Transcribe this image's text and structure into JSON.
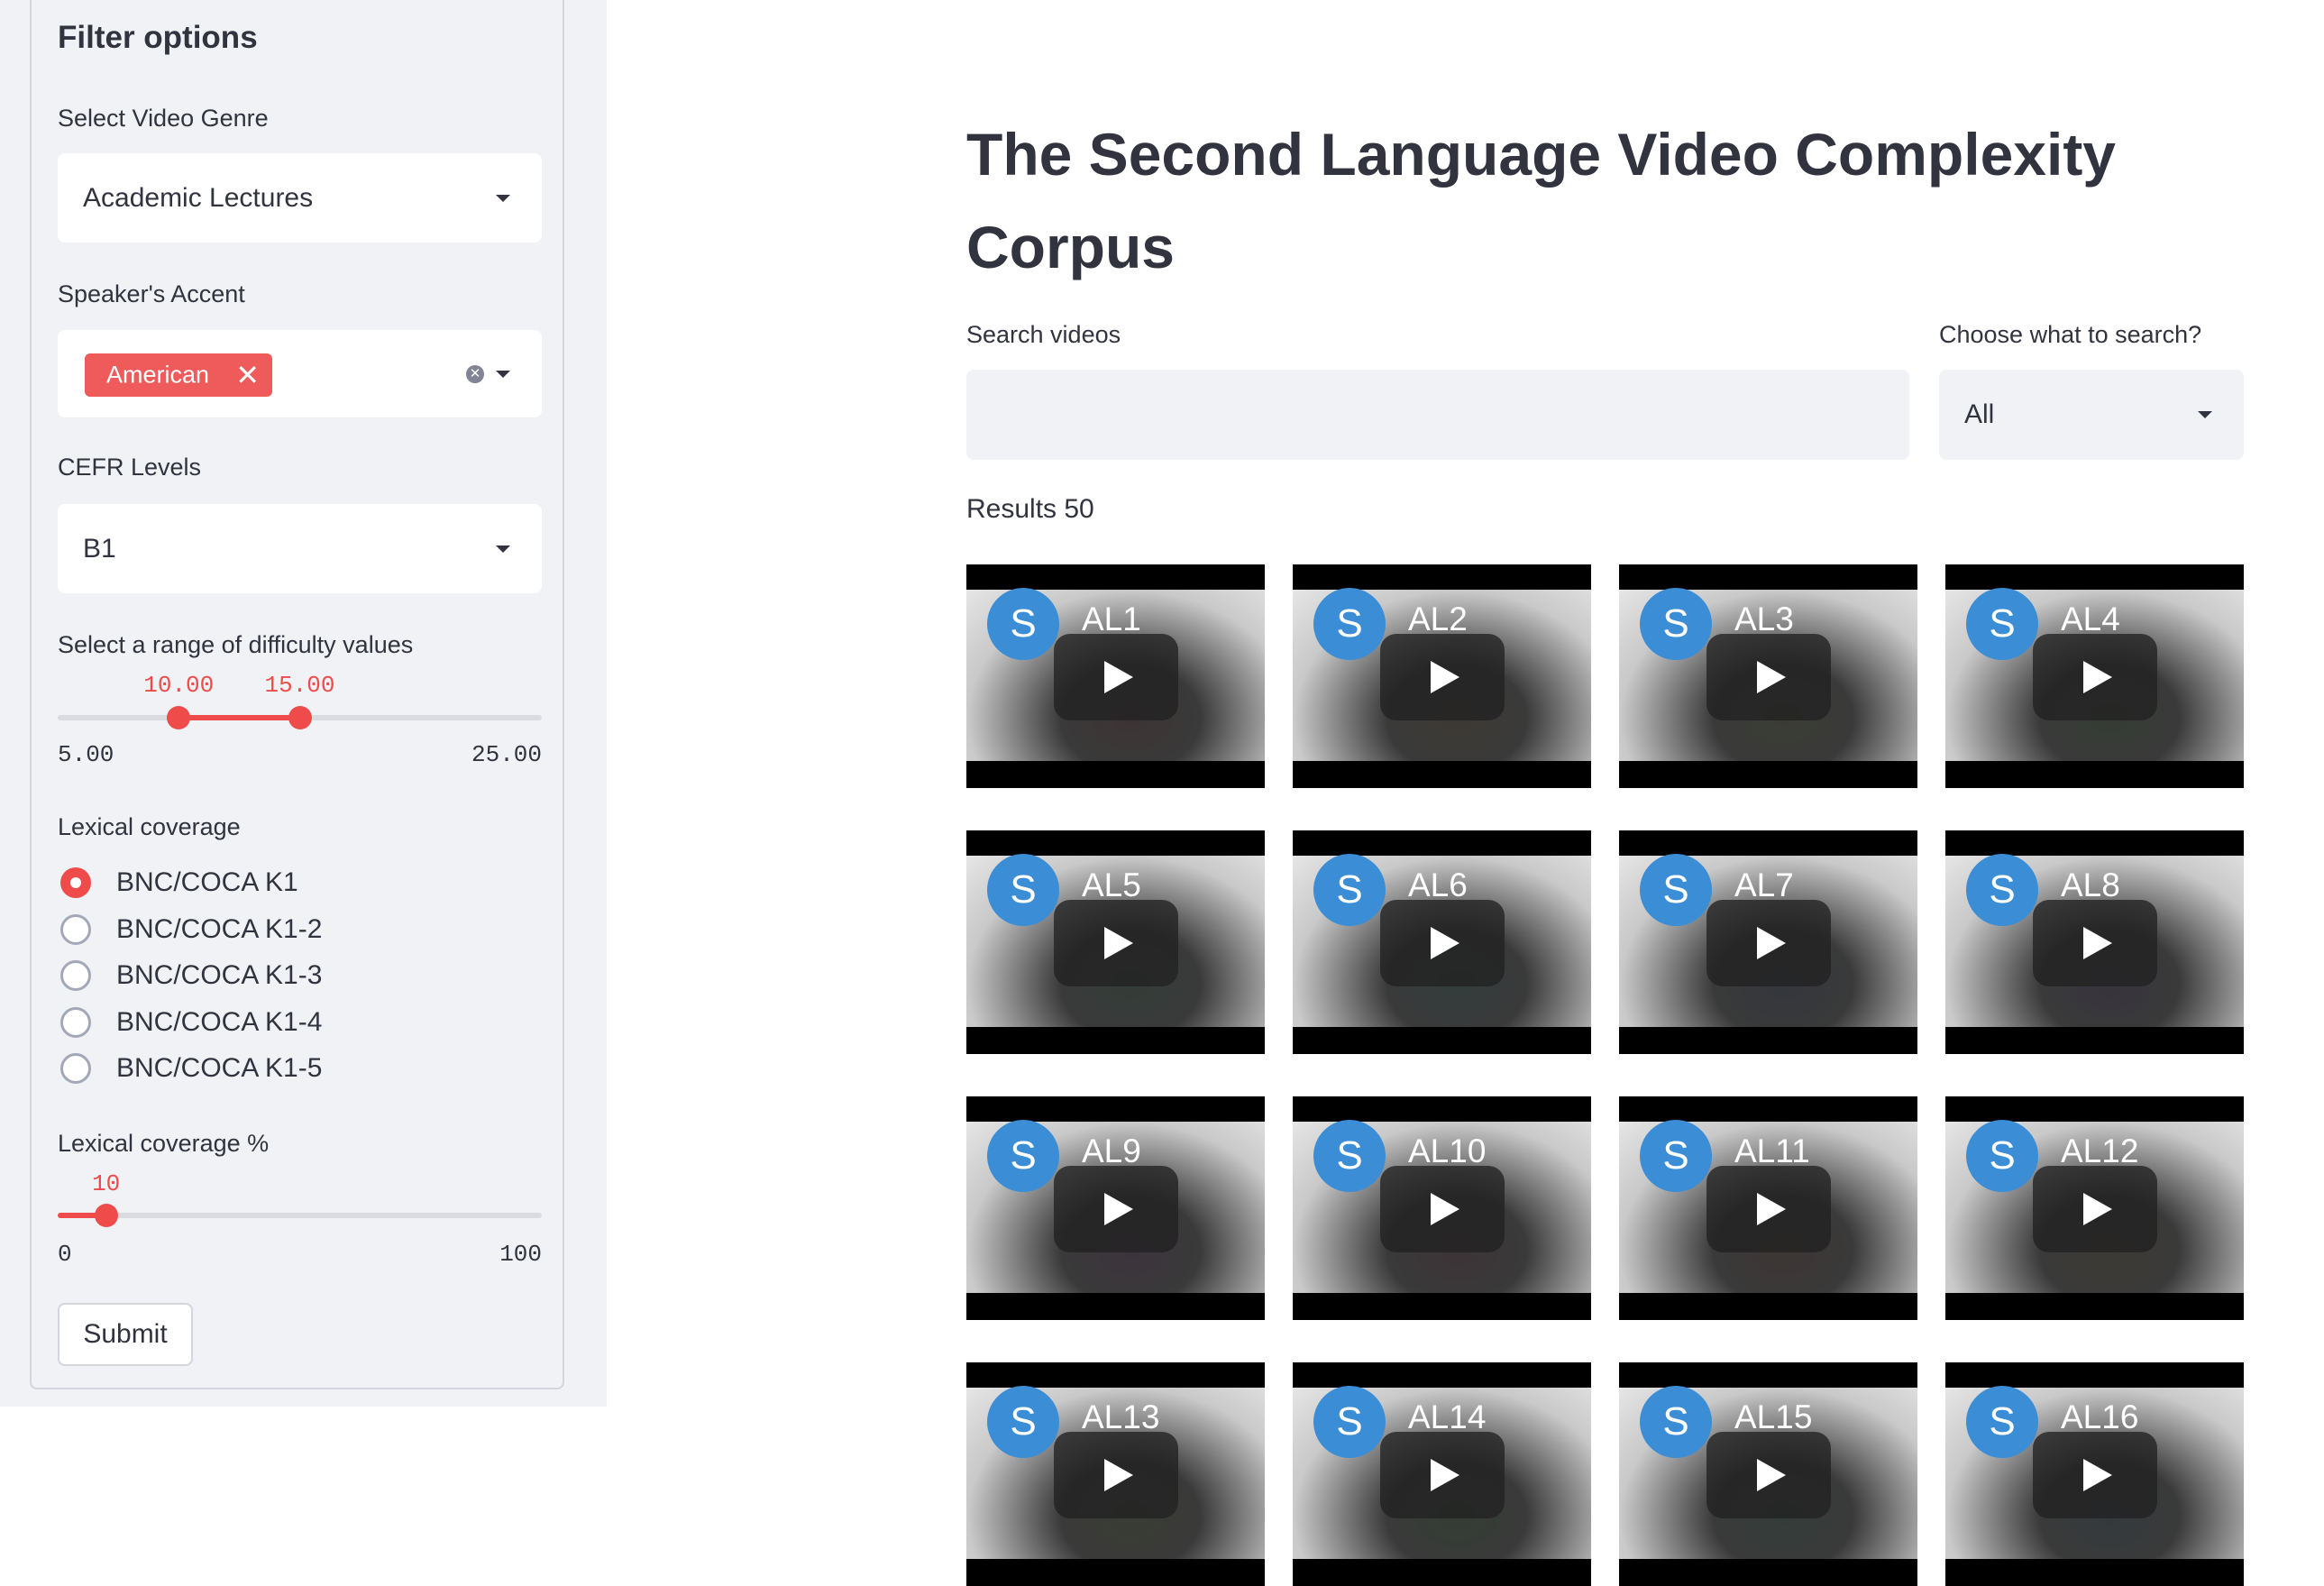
{
  "sidebar": {
    "title": "Filter options",
    "genre": {
      "label": "Select Video Genre",
      "value": "Academic Lectures"
    },
    "accent": {
      "label": "Speaker's Accent",
      "tag": "American"
    },
    "cefr": {
      "label": "CEFR Levels",
      "value": "B1"
    },
    "difficulty": {
      "label": "Select a range of difficulty values",
      "low": "10.00",
      "high": "15.00",
      "min": "5.00",
      "max": "25.00",
      "low_value": 10,
      "high_value": 15,
      "min_value": 5,
      "max_value": 25
    },
    "lexical": {
      "label": "Lexical coverage",
      "options": [
        "BNC/COCA K1",
        "BNC/COCA K1-2",
        "BNC/COCA K1-3",
        "BNC/COCA K1-4",
        "BNC/COCA K1-5"
      ],
      "selected": 0
    },
    "coverage_pct": {
      "label": "Lexical coverage %",
      "value": "10",
      "min": "0",
      "max": "100",
      "numeric_value": 10
    },
    "submit_label": "Submit"
  },
  "main": {
    "title": "The Second Language Video Complexity Corpus",
    "search": {
      "label": "Search videos",
      "value": "",
      "placeholder": ""
    },
    "scope": {
      "label": "Choose what to search?",
      "value": "All"
    },
    "results_label": "Results 50",
    "avatar_letter": "S",
    "videos": [
      "AL1",
      "AL2",
      "AL3",
      "AL4",
      "AL5",
      "AL6",
      "AL7",
      "AL8",
      "AL9",
      "AL10",
      "AL11",
      "AL12",
      "AL13",
      "AL14",
      "AL15",
      "AL16"
    ]
  },
  "colors": {
    "accent": "#ef4b4b",
    "tag": "#ef5a5a",
    "sidebar_bg": "#f0f2f6",
    "avatar": "#3b8ed6"
  }
}
